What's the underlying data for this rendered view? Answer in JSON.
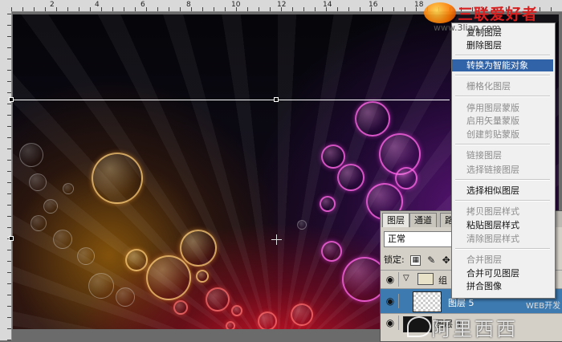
{
  "ruler": {
    "top_numbers": [
      "2",
      "4",
      "6",
      "8",
      "10",
      "12",
      "14",
      "16",
      "18"
    ]
  },
  "layers_panel": {
    "tabs": [
      "图层",
      "通道",
      "路"
    ],
    "blend_mode": "正常",
    "lock_label": "锁定:",
    "layers": [
      {
        "name": "组",
        "type": "group"
      },
      {
        "name": "图层 5",
        "type": "layer",
        "selected": true
      },
      {
        "name": "图层 4",
        "type": "layer",
        "selected": false
      }
    ]
  },
  "context_menu": {
    "items": [
      {
        "label": "复制图层",
        "enabled": true
      },
      {
        "label": "删除图层",
        "enabled": true
      },
      {
        "label": "转换为智能对象",
        "enabled": true,
        "highlighted": true
      },
      {
        "label": "栅格化图层",
        "enabled": false
      },
      {
        "label": "停用图层蒙版",
        "enabled": false
      },
      {
        "label": "启用矢量蒙版",
        "enabled": false
      },
      {
        "label": "创建剪贴蒙版",
        "enabled": false
      },
      {
        "label": "链接图层",
        "enabled": false
      },
      {
        "label": "选择链接图层",
        "enabled": false
      },
      {
        "label": "选择相似图层",
        "enabled": true
      },
      {
        "label": "拷贝图层样式",
        "enabled": false
      },
      {
        "label": "粘贴图层样式",
        "enabled": true
      },
      {
        "label": "清除图层样式",
        "enabled": false
      },
      {
        "label": "合并图层",
        "enabled": false
      },
      {
        "label": "合并可见图层",
        "enabled": true
      },
      {
        "label": "拼合图像",
        "enabled": true
      }
    ]
  },
  "watermarks": {
    "top_text": "三联爱好者",
    "top_url": "www.3lian.com",
    "bottom_text": "阿里西西",
    "web_label": "WEB开发"
  },
  "colors": {
    "menu_highlight": "#3163a8",
    "panel_bg": "#d4d0c8",
    "selected_layer": "#3d7ab0"
  }
}
